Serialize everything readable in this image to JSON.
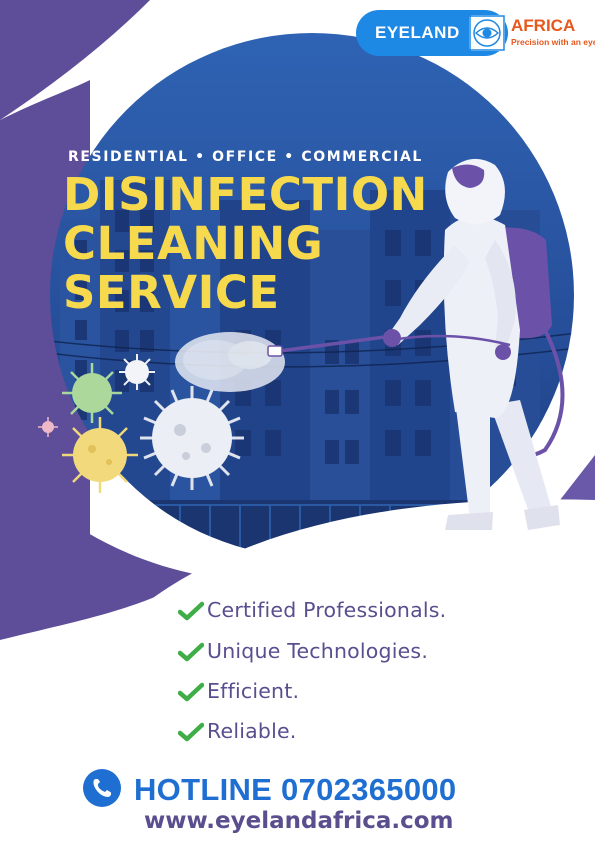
{
  "logo": {
    "brand_left": "EYELAND",
    "brand_right": "AFRICA",
    "tagline": "Precision with an eye",
    "mark_icon": "eye-emblem-icon"
  },
  "hero": {
    "subtitle": "RESIDENTIAL • OFFICE • COMMERCIAL",
    "title_lines": [
      "DISINFECTION",
      "CLEANING",
      "SERVICE"
    ],
    "illustration_icons": [
      "city-buildings-icon",
      "hazmat-worker-icon",
      "virus-icon",
      "spray-mist-icon"
    ]
  },
  "features": [
    {
      "label": "Certified Professionals.",
      "icon": "checkmark-icon"
    },
    {
      "label": "Unique Technologies.",
      "icon": "checkmark-icon"
    },
    {
      "label": "Efficient.",
      "icon": "checkmark-icon"
    },
    {
      "label": "Reliable.",
      "icon": "checkmark-icon"
    }
  ],
  "contact": {
    "hotline": "HOTLINE 0702365000",
    "phone_icon": "phone-icon",
    "website": "www.eyelandafrica.com"
  },
  "colors": {
    "purple": "#5e4e99",
    "navy": "#1c3670",
    "blue_accent": "#1e6fd1",
    "yellow_title": "#f6d94d",
    "orange_brand": "#e8571c",
    "check_green": "#3fae49"
  }
}
